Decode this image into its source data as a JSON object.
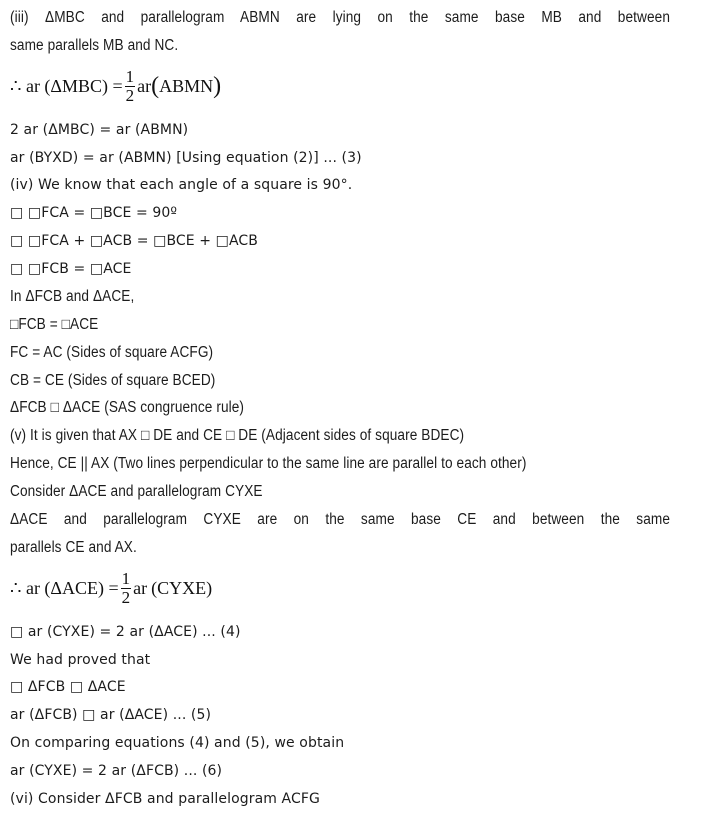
{
  "lines": [
    {
      "text": "(iii) ΔMBC and parallelogram ABMN are lying on the same base MB and between",
      "style": "cond-just"
    },
    {
      "text": "same parallels MB and NC.",
      "style": "cond"
    },
    {
      "math": {
        "prefix": "∴ ar (ΔMBC) =",
        "numerator": "1",
        "denominator": "2",
        "suffix_pre": "ar",
        "suffix": "ABMN"
      }
    },
    {
      "text": "2 ar (ΔMBC) = ar (ABMN)"
    },
    {
      "text": "ar (BYXD) = ar (ABMN) [Using equation (2)] ... (3)"
    },
    {
      "text": "(iv) We know that each angle of a square is 90°."
    },
    {
      "text": "□ □FCA = □BCE = 90º"
    },
    {
      "text": "□ □FCA + □ACB = □BCE + □ACB"
    },
    {
      "text": "□ □FCB = □ACE"
    },
    {
      "text": "In ΔFCB and ΔACE,",
      "style": "cond"
    },
    {
      "text": "□FCB = □ACE",
      "style": "cond"
    },
    {
      "text": "FC = AC (Sides of square ACFG)",
      "style": "cond"
    },
    {
      "text": "CB = CE (Sides of square BCED)",
      "style": "cond"
    },
    {
      "text": "ΔFCB □ ΔACE (SAS congruence rule)",
      "style": "cond"
    },
    {
      "text": "(v) It is given that AX □ DE and CE □ DE (Adjacent sides of square BDEC)",
      "style": "cond"
    },
    {
      "text": "Hence, CE || AX (Two lines perpendicular to the same line are parallel to each other)",
      "style": "cond"
    },
    {
      "text": "Consider ΔACE and parallelogram CYXE",
      "style": "cond"
    },
    {
      "text": "ΔACE and parallelogram CYXE are on the same base CE and between the same",
      "style": "cond-just"
    },
    {
      "text": "parallels CE and AX.",
      "style": "cond"
    },
    {
      "math": {
        "prefix": "∴ ar (ΔACE) =",
        "numerator": "1",
        "denominator": "2",
        "suffix_pre": "ar",
        "suffix": "(CYXE)"
      }
    },
    {
      "text": "□ ar (CYXE) = 2 ar (ΔACE) ... (4)"
    },
    {
      "text": "We had proved that"
    },
    {
      "text": "□ ΔFCB □ ΔACE"
    },
    {
      "text": "ar (ΔFCB) □ ar (ΔACE) ... (5)"
    },
    {
      "text": "On comparing equations (4) and (5), we obtain"
    },
    {
      "text": "ar (CYXE) = 2 ar (ΔFCB) ... (6)"
    },
    {
      "text": "(vi) Consider ΔFCB and parallelogram ACFG"
    }
  ]
}
